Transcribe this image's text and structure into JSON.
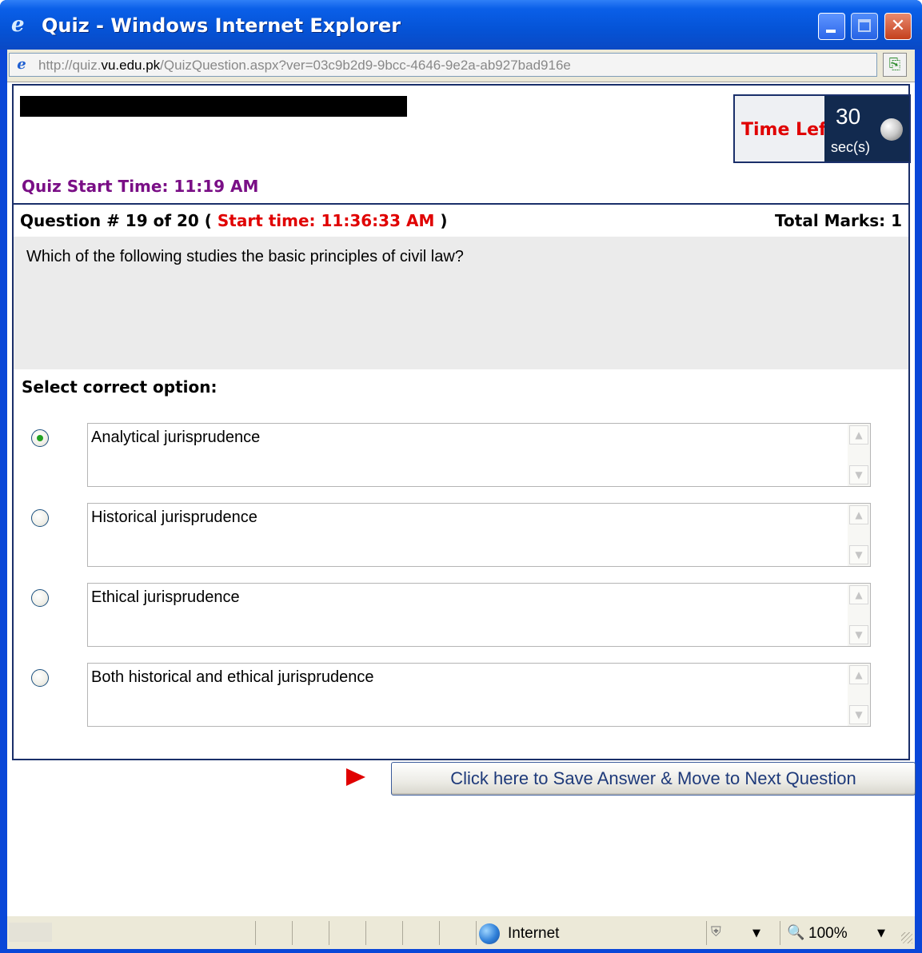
{
  "window": {
    "title": "Quiz - Windows Internet Explorer",
    "app_icon": "ie-logo-icon",
    "buttons": {
      "minimize": "minimize-icon",
      "maximize": "maximize-icon",
      "close": "close-icon",
      "close_glyph": "✕"
    }
  },
  "address": {
    "prefix": "http://quiz.",
    "host": "vu.edu.pk",
    "path": "/QuizQuestion.aspx?ver=03c9b2d9-9bcc-4646-9e2a-ab927bad916e"
  },
  "timer": {
    "label": "Time Left",
    "value": "30",
    "unit": "sec(s)",
    "label_color": "#e00000"
  },
  "quiz": {
    "start_time": "Quiz Start Time: 11:19 AM",
    "question_number": "Question # 19 of 20 ( ",
    "question_start": "Start time: 11:36:33 AM",
    "question_close": " )",
    "total_marks": "Total Marks: 1",
    "question_text": "Which of the following studies the basic principles of civil law?",
    "select_label": "Select correct option:",
    "options": [
      {
        "text": "Analytical jurisprudence",
        "selected": true
      },
      {
        "text": "Historical jurisprudence",
        "selected": false
      },
      {
        "text": "Ethical jurisprudence",
        "selected": false
      },
      {
        "text": "Both historical and ethical jurisprudence",
        "selected": false
      }
    ],
    "save_button": "Click here to Save Answer & Move to Next Question"
  },
  "statusbar": {
    "zone": "Internet",
    "zoom": "100%",
    "zoom_icon": "🔍",
    "caret": "▼"
  },
  "colors": {
    "accent_red": "#e00000",
    "start_time_purple": "#7a0f86",
    "timer_dark": "#122a4f",
    "title_blue": "#0553d6"
  }
}
